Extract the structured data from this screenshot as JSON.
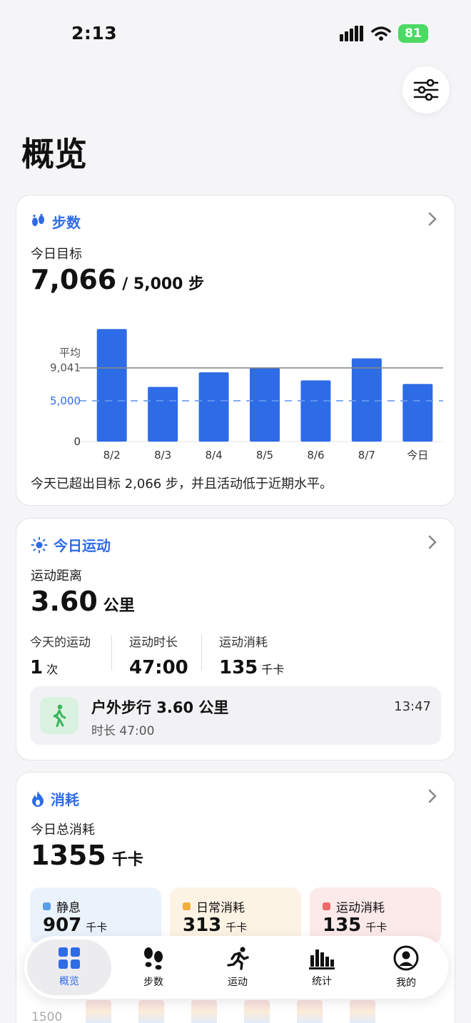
{
  "status_bar": {
    "time": "2:13",
    "battery": "81"
  },
  "page_title": "概览",
  "steps_card": {
    "title": "步数",
    "goal_label": "今日目标",
    "value": "7,066",
    "goal_text": "/ 5,000 步",
    "summary": "今天已超出目标 2,066 步，并且活动低于近期水平。"
  },
  "chart_data": {
    "type": "bar",
    "categories": [
      "8/2",
      "8/3",
      "8/4",
      "8/5",
      "8/6",
      "8/7",
      "今日"
    ],
    "values": [
      13800,
      6700,
      8500,
      9100,
      7500,
      10200,
      7066
    ],
    "ylim": [
      0,
      14000
    ],
    "reference_lines": [
      {
        "label_top": "平均",
        "label": "9,041",
        "value": 9041,
        "style": "solid",
        "color": "#888888"
      },
      {
        "label": "5,000",
        "value": 5000,
        "style": "dashed",
        "color": "#6b9bf0"
      }
    ],
    "y_zero_label": "0",
    "bar_color": "#2e6be6",
    "grid": false
  },
  "exercise_card": {
    "title": "今日运动",
    "distance_label": "运动距离",
    "distance_value": "3.60",
    "distance_unit": "公里",
    "stats": [
      {
        "label": "今天的运动",
        "value": "1",
        "unit": "次"
      },
      {
        "label": "运动时长",
        "value": "47:00",
        "unit": ""
      },
      {
        "label": "运动消耗",
        "value": "135",
        "unit": "千卡"
      }
    ],
    "workout": {
      "title": "户外步行 3.60 公里",
      "duration": "时长 47:00",
      "time": "13:47"
    }
  },
  "calories_card": {
    "title": "消耗",
    "total_label": "今日总消耗",
    "total_value": "1355",
    "total_unit": "千卡",
    "items": [
      {
        "label": "静息",
        "value": "907",
        "unit": "千卡",
        "color": "#5b9ee8",
        "bg": "#eaf2fc"
      },
      {
        "label": "日常消耗",
        "value": "313",
        "unit": "千卡",
        "color": "#f0b040",
        "bg": "#fdf3e4"
      },
      {
        "label": "运动消耗",
        "value": "135",
        "unit": "千卡",
        "color": "#ec6a6a",
        "bg": "#fce9e9"
      }
    ],
    "peek_axis_label": "1500"
  },
  "tabbar": {
    "tabs": [
      {
        "label": "概览",
        "icon": "grid-icon"
      },
      {
        "label": "步数",
        "icon": "footprints-icon"
      },
      {
        "label": "运动",
        "icon": "running-icon"
      },
      {
        "label": "统计",
        "icon": "bar-chart-icon"
      },
      {
        "label": "我的",
        "icon": "person-icon"
      }
    ]
  },
  "colors": {
    "accent": "#2e6be6",
    "workout_icon_bg": "#d9f2e0",
    "workout_icon": "#3bb35a"
  }
}
